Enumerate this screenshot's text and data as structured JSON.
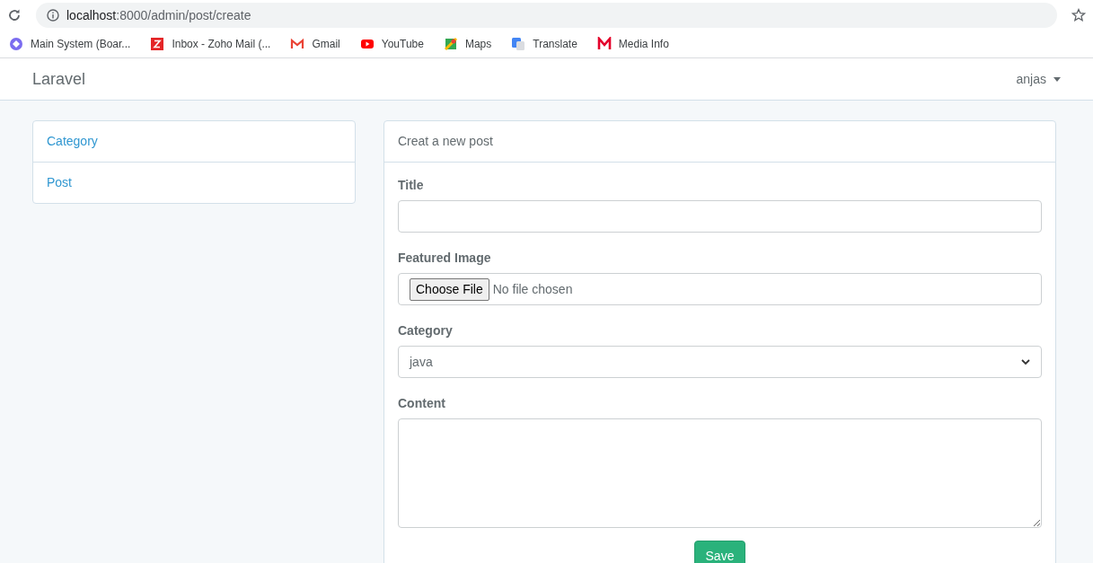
{
  "browser": {
    "url_host": "localhost",
    "url_path": ":8000/admin/post/create",
    "bookmarks": [
      {
        "label": "Main System (Boar...",
        "kind": "circle",
        "color": "#7b6cf0"
      },
      {
        "label": "Inbox - Zoho Mail (...",
        "kind": "zoho",
        "color": "#e42527"
      },
      {
        "label": "Gmail",
        "kind": "gmail",
        "color": "#ea4335"
      },
      {
        "label": "YouTube",
        "kind": "youtube",
        "color": "#ff0000"
      },
      {
        "label": "Maps",
        "kind": "maps",
        "color": "#34a853"
      },
      {
        "label": "Translate",
        "kind": "translate",
        "color": "#4285f4"
      },
      {
        "label": "Media Info",
        "kind": "letter",
        "color": "#e4002b"
      }
    ]
  },
  "navbar": {
    "brand": "Laravel",
    "user": "anjas"
  },
  "sidebar": {
    "items": [
      {
        "label": "Category"
      },
      {
        "label": "Post"
      }
    ]
  },
  "form": {
    "title": "Creat a new post",
    "fields": [
      {
        "kind": "text",
        "label": "Title"
      },
      {
        "kind": "file",
        "label": "Featured Image",
        "button": "Choose File",
        "status": "No file chosen"
      },
      {
        "kind": "select",
        "label": "Category",
        "value": "java"
      },
      {
        "kind": "textarea",
        "label": "Content"
      }
    ],
    "submit": "Save"
  }
}
